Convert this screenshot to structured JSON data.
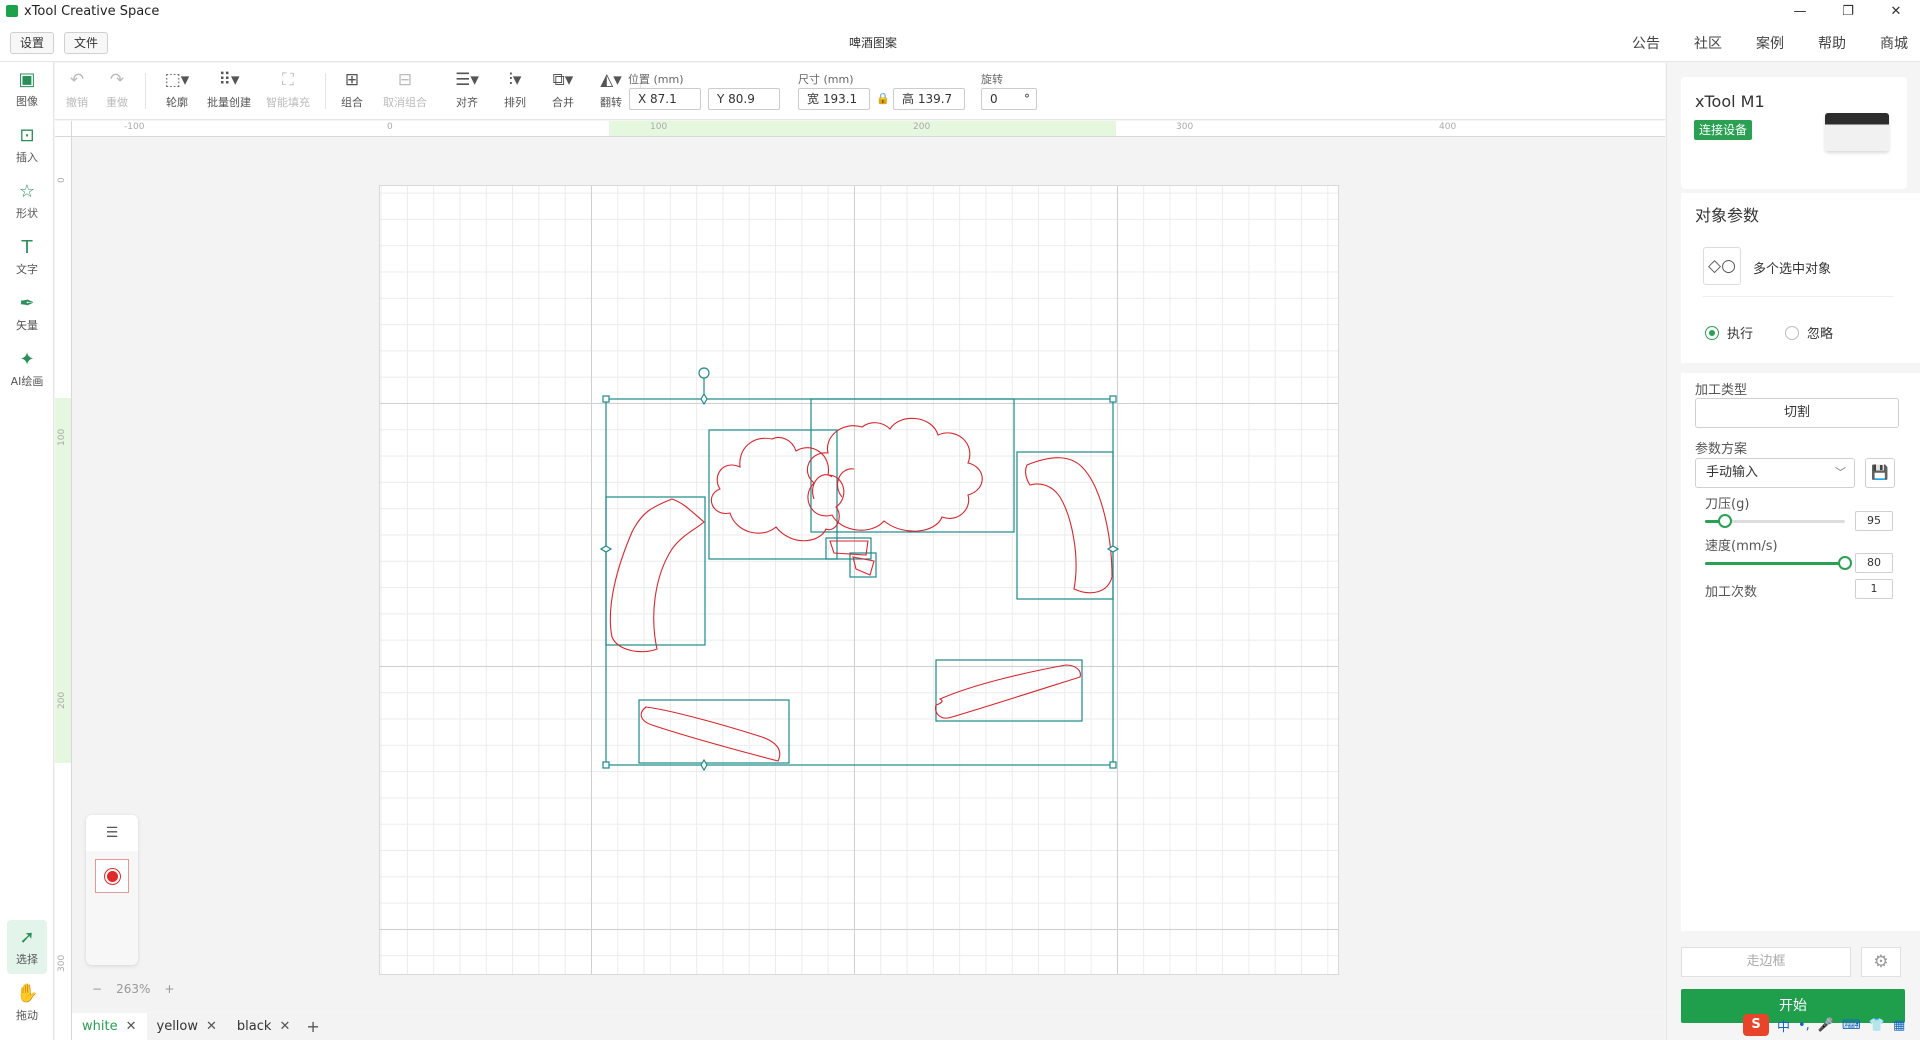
{
  "window": {
    "title": "xTool Creative Space",
    "minimize": "—",
    "restore": "❐",
    "close": "✕"
  },
  "menu": {
    "settings": "设置",
    "file": "文件",
    "doc_title": "啤酒图案",
    "nav": [
      "公告",
      "社区",
      "案例",
      "帮助",
      "商城"
    ]
  },
  "left_tools": [
    {
      "name": "image",
      "label": "图像",
      "icon": "image-icon",
      "glyph": "▣"
    },
    {
      "name": "insert",
      "label": "插入",
      "icon": "insert-icon",
      "glyph": "⊡"
    },
    {
      "name": "shape",
      "label": "形状",
      "icon": "star-icon",
      "glyph": "☆"
    },
    {
      "name": "text",
      "label": "文字",
      "icon": "text-icon",
      "glyph": "T"
    },
    {
      "name": "vector",
      "label": "矢量",
      "icon": "pen-icon",
      "glyph": "✒"
    },
    {
      "name": "ai",
      "label": "AI绘画",
      "icon": "ai-icon",
      "glyph": "✦"
    }
  ],
  "bottom_left_tools": [
    {
      "name": "select",
      "label": "选择",
      "icon": "cursor-icon",
      "glyph": "➚",
      "active": true
    },
    {
      "name": "drag",
      "label": "拖动",
      "icon": "hand-icon",
      "glyph": "✋",
      "active": false
    }
  ],
  "toolbar": {
    "undo": "撤销",
    "redo": "重做",
    "outline": "轮廓",
    "batch": "批量创建",
    "fill": "智能填充",
    "group": "组合",
    "ungroup": "取消组合",
    "align": "对齐",
    "arrange": "排列",
    "merge": "合并",
    "flip": "翻转",
    "position_label": "位置 (mm)",
    "x": "X 87.1",
    "y": "Y 80.9",
    "size_label": "尺寸 (mm)",
    "w": "宽 193.1",
    "h": "高 139.7",
    "rotate_label": "旋转",
    "rotate": "0",
    "rotate_unit": "°"
  },
  "ruler": {
    "top": [
      "-100",
      "0",
      "100",
      "200",
      "300",
      "400"
    ],
    "left": [
      "0",
      "100",
      "200",
      "300"
    ]
  },
  "canvas": {
    "zoom": "263%",
    "zoom_minus": "−",
    "zoom_plus": "+",
    "stroke_color": "#d9262c",
    "box_color": "#1c8a8a"
  },
  "tabs": [
    {
      "label": "white",
      "active": true
    },
    {
      "label": "yellow",
      "active": false
    },
    {
      "label": "black",
      "active": false
    }
  ],
  "tab_add": "+",
  "device": {
    "name": "xTool M1",
    "connect": "连接设备"
  },
  "params": {
    "title": "对象参数",
    "multi": "多个选中对象",
    "execute": "执行",
    "ignore": "忽略",
    "process_type_label": "加工类型",
    "process_type": "切割",
    "scheme_label": "参数方案",
    "scheme": "手动输入",
    "pressure_label": "刀压(g)",
    "pressure": "95",
    "pressure_pct": 0.14,
    "speed_label": "速度(mm/s)",
    "speed": "80",
    "speed_pct": 1.0,
    "passes_label": "加工次数",
    "passes": "1"
  },
  "actions": {
    "frame": "走边框",
    "start": "开始"
  },
  "ime": {
    "logo": "S",
    "lang": "中",
    "punct": "•,",
    "mic": "🎤",
    "kbd": "⌨",
    "shirt": "👕",
    "grid": "▦"
  }
}
